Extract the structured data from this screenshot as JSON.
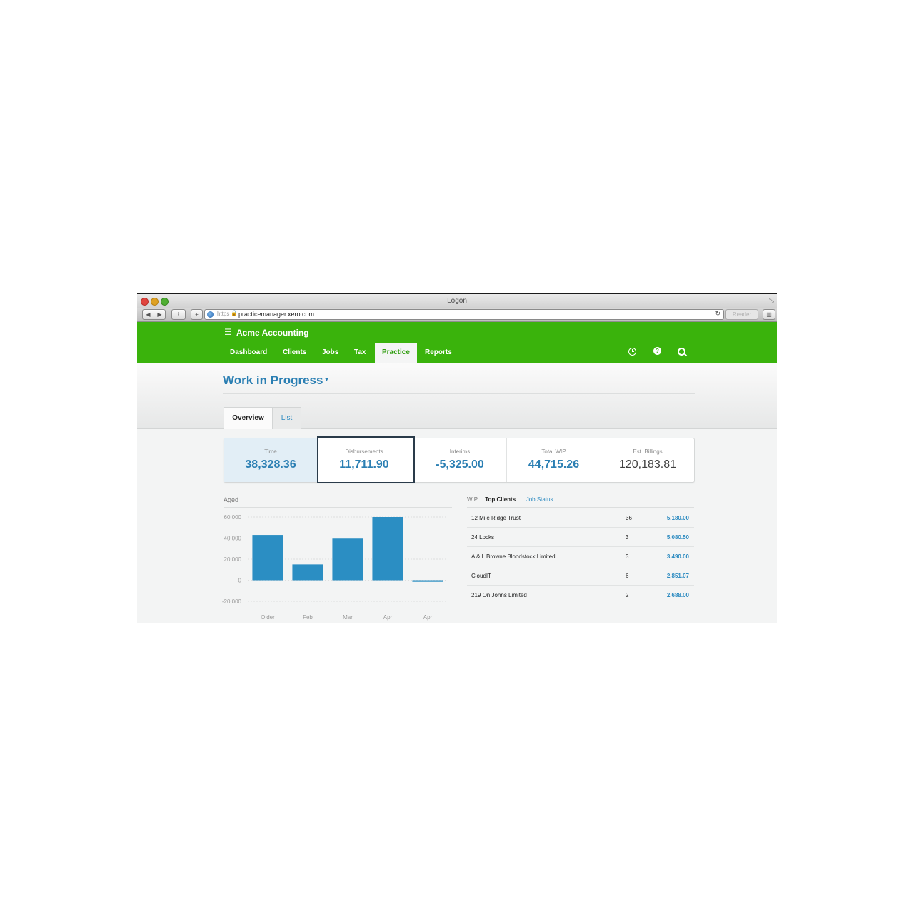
{
  "browser": {
    "window_title": "Logon",
    "url_scheme": "https",
    "url": "practicemanager.xero.com",
    "reader_label": "Reader"
  },
  "header": {
    "org_name": "Acme Accounting",
    "nav": [
      "Dashboard",
      "Clients",
      "Jobs",
      "Tax",
      "Practice",
      "Reports"
    ],
    "active_nav": "Practice"
  },
  "page": {
    "title": "Work in Progress",
    "tabs": [
      "Overview",
      "List"
    ],
    "active_tab": "Overview"
  },
  "summary": [
    {
      "label": "Time",
      "value": "38,328.36"
    },
    {
      "label": "Disbursements",
      "value": "11,711.90"
    },
    {
      "label": "Interims",
      "value": "-5,325.00"
    },
    {
      "label": "Total WIP",
      "value": "44,715.26"
    },
    {
      "label": "Est. Billings",
      "value": "120,183.81"
    }
  ],
  "aged": {
    "label": "Aged"
  },
  "chart_data": {
    "type": "bar",
    "categories": [
      "Older",
      "Feb",
      "Mar",
      "Apr",
      "Apr"
    ],
    "values": [
      43000,
      15000,
      39500,
      60000,
      -1500
    ],
    "y_ticks": [
      "60,000",
      "40,000",
      "20,000",
      "0",
      "-20,000"
    ],
    "ylim": [
      -20000,
      60000
    ],
    "grid": true,
    "color": "#2b8ec3"
  },
  "clients_panel": {
    "tabs": {
      "wip": "WIP",
      "top_clients": "Top Clients",
      "separator": "|",
      "job_status": "Job Status"
    },
    "rows": [
      {
        "name": "12 Mile Ridge Trust",
        "jobs": "36",
        "amount": "5,180.00"
      },
      {
        "name": "24 Locks",
        "jobs": "3",
        "amount": "5,080.50"
      },
      {
        "name": "A & L Browne Bloodstock Limited",
        "jobs": "3",
        "amount": "3,490.00"
      },
      {
        "name": "CloudIT",
        "jobs": "6",
        "amount": "2,851.07"
      },
      {
        "name": "219 On Johns Limited",
        "jobs": "2",
        "amount": "2,688.00"
      }
    ]
  },
  "colors": {
    "brand_green": "#3ab30c",
    "link_blue": "#2b7fb3"
  }
}
